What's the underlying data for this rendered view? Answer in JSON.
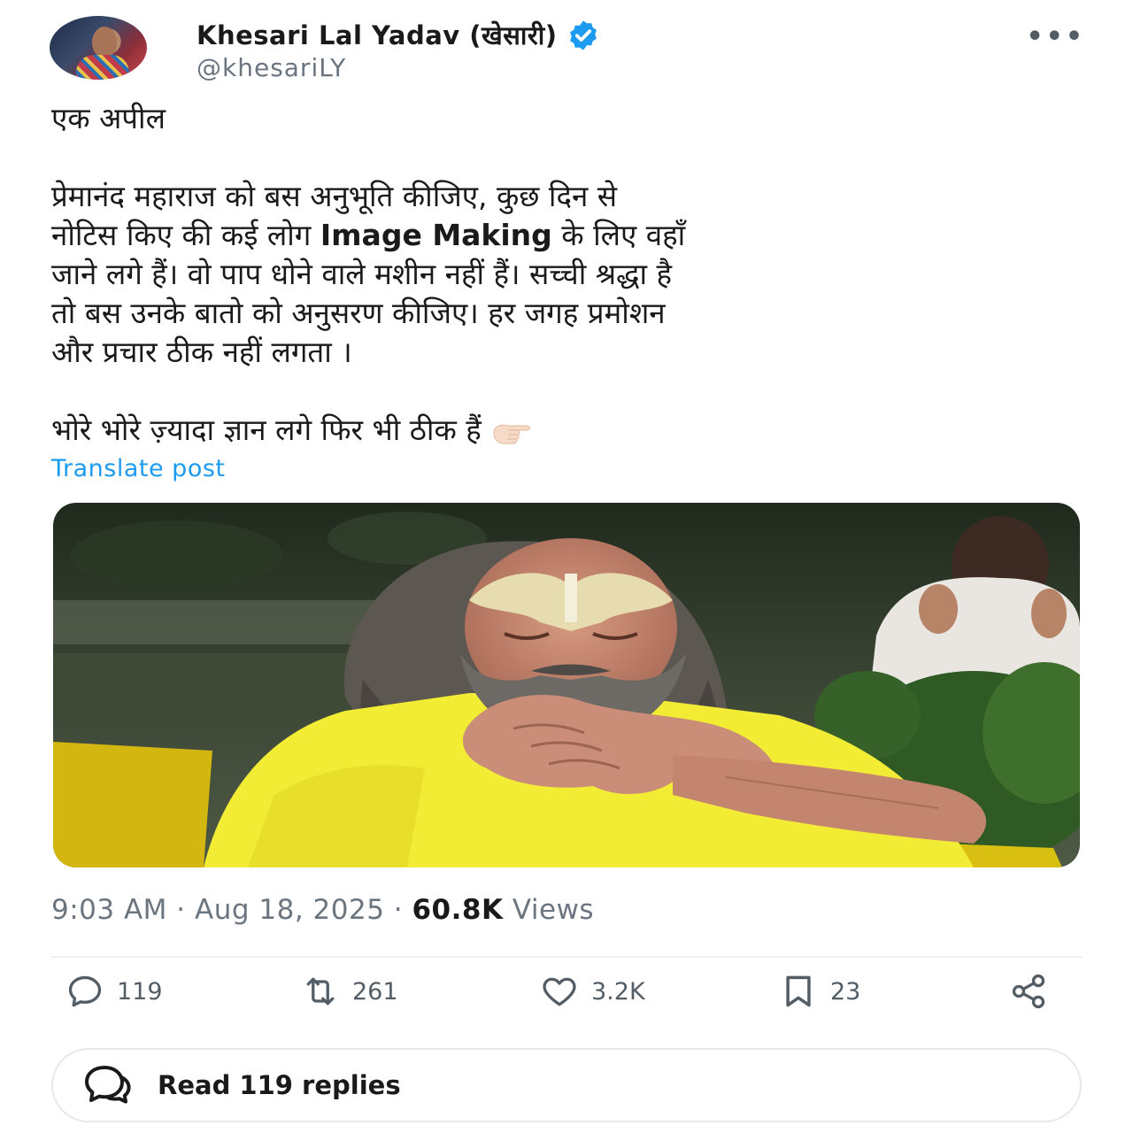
{
  "author": {
    "name": "Khesari Lal Yadav (खेसारी)",
    "handle": "@khesariLY",
    "verified": true,
    "verified_color": "#1d9bf0"
  },
  "more_label": "•••",
  "tweet": {
    "line1": "एक अपील",
    "para2_l1": "प्रेमानंद महाराज को बस अनुभूति कीजिए, कुछ दिन से",
    "para2_l2_a": "नोटिस किए की कई लोग ",
    "para2_l2_bold": "Image Making",
    "para2_l2_b": " के लिए वहाँ",
    "para2_l3": "जाने लगे हैं। वो पाप धोने वाले मशीन नहीं हैं। सच्ची श्रद्धा है",
    "para2_l4": "तो बस उनके बातो को अनुसरण कीजिए। हर जगह प्रमोशन",
    "para2_l5": "और प्रचार ठीक नहीं लगता ।",
    "para3": "भोरे भोरे ज़्यादा ज्ञान लगे फिर भी ठीक हैं "
  },
  "translate_label": "Translate post",
  "meta": {
    "time": "9:03 AM",
    "sep1": " · ",
    "date": "Aug 18, 2025",
    "sep2": " · ",
    "views_count": "60.8K",
    "views_label": " Views"
  },
  "actions": {
    "replies": "119",
    "reposts": "261",
    "likes": "3.2K",
    "bookmarks": "23"
  },
  "read_replies_label": "Read 119 replies",
  "colors": {
    "link": "#1d9bf0",
    "muted": "#6b7580",
    "icon": "#535d66"
  }
}
